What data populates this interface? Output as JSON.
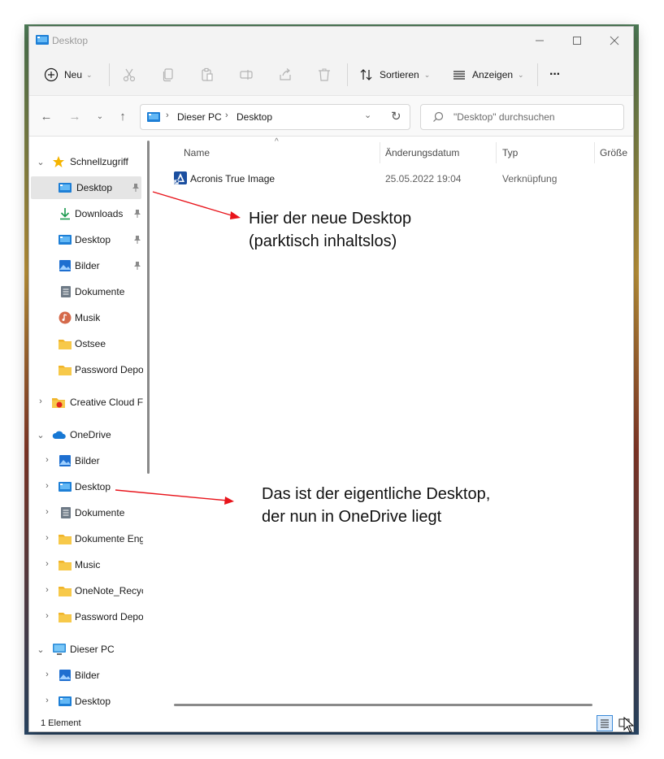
{
  "window": {
    "title": "Desktop"
  },
  "toolbar": {
    "new_label": "Neu",
    "sort_label": "Sortieren",
    "view_label": "Anzeigen",
    "more_label": "···"
  },
  "address": {
    "crumb_root": "Dieser PC",
    "crumb_current": "Desktop",
    "search_placeholder": "\"Desktop\" durchsuchen"
  },
  "nav": {
    "quick_access": "Schnellzugriff",
    "qa_desktop": "Desktop",
    "qa_downloads": "Downloads",
    "qa_desktop2": "Desktop",
    "qa_bilder": "Bilder",
    "qa_dokumente": "Dokumente",
    "qa_musik": "Musik",
    "qa_ostsee": "Ostsee",
    "qa_password": "Password Depot",
    "creative_cloud": "Creative Cloud Files",
    "onedrive": "OneDrive",
    "od_bilder": "Bilder",
    "od_desktop": "Desktop",
    "od_dokumente": "Dokumente",
    "od_dokumente_en": "Dokumente Englisch",
    "od_music": "Music",
    "od_onenote": "OneNote_RecycleBin",
    "od_password": "Password Depot",
    "this_pc": "Dieser PC",
    "pc_bilder": "Bilder",
    "pc_desktop": "Desktop"
  },
  "columns": {
    "name": "Name",
    "date": "Änderungsdatum",
    "type": "Typ",
    "size": "Größe"
  },
  "files": [
    {
      "name": "Acronis True Image",
      "date": "25.05.2022 19:04",
      "type": "Verknüpfung"
    }
  ],
  "status": {
    "count": "1 Element"
  },
  "annotations": {
    "top_line1": "Hier der neue Desktop",
    "top_line2": "(parktisch inhaltslos)",
    "bottom_line1": "Das ist der eigentliche Desktop,",
    "bottom_line2": "der nun in OneDrive liegt"
  },
  "colors": {
    "accent": "#0067c0",
    "folder_yellow": "#f7c94a",
    "arrow_red": "#e8141b"
  }
}
